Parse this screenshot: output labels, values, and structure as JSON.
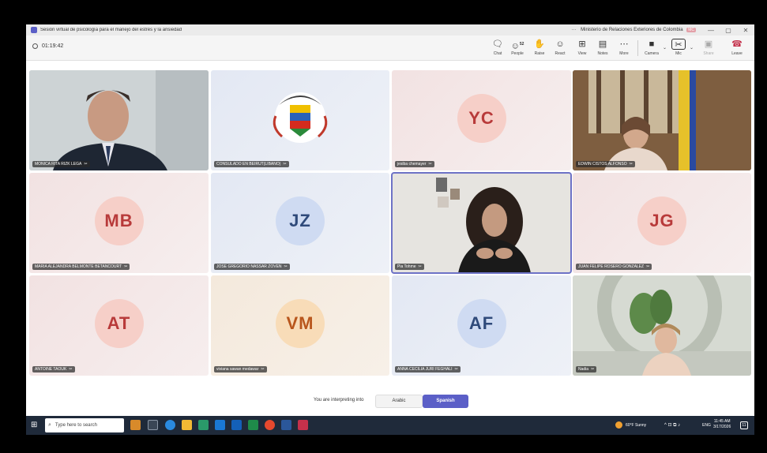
{
  "window": {
    "title": "Sesión virtual de psicología para el manejo del estrés y la ansiedad",
    "org": "Ministerio de Relaciones Exteriores de Colombia",
    "org_badge": "MC",
    "more": "···",
    "minimize": "—",
    "restore": "▢",
    "close": "✕"
  },
  "toolbar": {
    "elapsed": "01:19:42",
    "chat": "Chat",
    "people": "People",
    "people_count": "52",
    "raise": "Raise",
    "react": "React",
    "view": "View",
    "notes": "Notes",
    "more": "More",
    "camera": "Camera",
    "mic": "Mic",
    "share": "Share",
    "leave": "Leave"
  },
  "participants": [
    {
      "name": "MONICA RITA RIZK LEGA",
      "initials": "",
      "video": true
    },
    {
      "name": "CONSULADO EN BEIRUT(LIBANO)",
      "initials": "",
      "video": true
    },
    {
      "name": "jesiba chemayer",
      "initials": "YC",
      "video": false
    },
    {
      "name": "EDWIN CISTOS ALFONSO",
      "initials": "",
      "video": true
    },
    {
      "name": "MARIA ALEJANDRA BELMONTE BETANCOURT",
      "initials": "MB",
      "video": false
    },
    {
      "name": "JOSE GREGORIO NASSAR ZOVEN",
      "initials": "JZ",
      "video": false
    },
    {
      "name": "Pia Tohme",
      "initials": "",
      "video": true
    },
    {
      "name": "JUAN FELIPE ROSERO GONZALEZ",
      "initials": "JG",
      "video": false
    },
    {
      "name": "ANTOINE TAOUK",
      "initials": "AT",
      "video": false
    },
    {
      "name": "viviana sawan medawar",
      "initials": "VM",
      "video": false
    },
    {
      "name": "ANNA CECILIA JURI FEGHALI",
      "initials": "AF",
      "video": false
    },
    {
      "name": "Nadia",
      "initials": "",
      "video": true
    }
  ],
  "interpretation": {
    "label": "You are interpreting into",
    "options": [
      "Arabic",
      "Spanish"
    ],
    "selected": "Spanish"
  },
  "taskbar": {
    "search_placeholder": "Type here to search",
    "weather": "60°F Sunny",
    "tray_icons": "^ ⊡ ⧉ ♪",
    "language": "ENG",
    "time": "11:45 AM",
    "date": "3/17/2026",
    "notifications": "11"
  },
  "colors": {
    "accent": "#5b5fc7",
    "leave": "#c4314b",
    "taskbar": "#1f2a3a"
  }
}
